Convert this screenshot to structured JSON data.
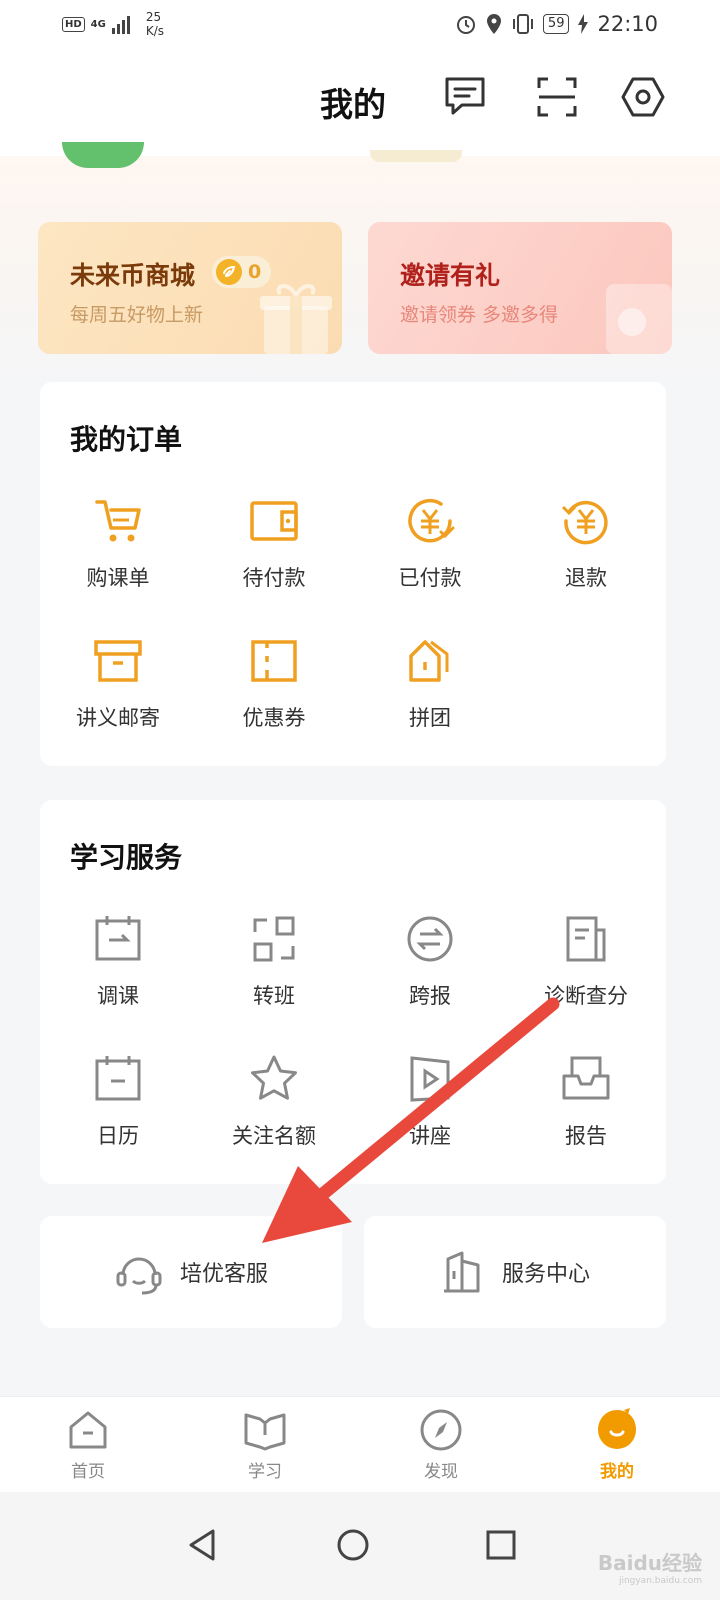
{
  "status_bar": {
    "hd": "HD",
    "network": "4G",
    "speed_value": "25",
    "speed_unit": "K/s",
    "battery": "59",
    "time": "22:10"
  },
  "header": {
    "title": "我的",
    "icons": [
      "message-icon",
      "scan-icon",
      "settings-icon"
    ]
  },
  "promos": {
    "mall": {
      "title": "未来币商城",
      "coin_count": "0",
      "subtitle": "每周五好物上新"
    },
    "invite": {
      "title": "邀请有礼",
      "subtitle": "邀请领券 多邀多得"
    }
  },
  "orders": {
    "title": "我的订单",
    "items": [
      {
        "label": "购课单",
        "icon": "cart-icon"
      },
      {
        "label": "待付款",
        "icon": "wallet-icon"
      },
      {
        "label": "已付款",
        "icon": "yuan-check-icon"
      },
      {
        "label": "退款",
        "icon": "yuan-refund-icon"
      },
      {
        "label": "讲义邮寄",
        "icon": "box-icon"
      },
      {
        "label": "优惠券",
        "icon": "coupon-icon"
      },
      {
        "label": "拼团",
        "icon": "group-buy-icon"
      }
    ]
  },
  "services": {
    "title": "学习服务",
    "items": [
      {
        "label": "调课",
        "icon": "reschedule-icon"
      },
      {
        "label": "转班",
        "icon": "transfer-class-icon"
      },
      {
        "label": "跨报",
        "icon": "cross-enroll-icon"
      },
      {
        "label": "诊断查分",
        "icon": "score-report-icon"
      },
      {
        "label": "日历",
        "icon": "calendar-icon"
      },
      {
        "label": "关注名额",
        "icon": "star-icon"
      },
      {
        "label": "讲座",
        "icon": "lecture-play-icon"
      },
      {
        "label": "报告",
        "icon": "inbox-report-icon"
      }
    ]
  },
  "support": {
    "customer_service": "培优客服",
    "service_center": "服务中心"
  },
  "bottom_nav": {
    "items": [
      {
        "label": "首页",
        "icon": "home-icon"
      },
      {
        "label": "学习",
        "icon": "book-icon"
      },
      {
        "label": "发现",
        "icon": "compass-icon"
      },
      {
        "label": "我的",
        "icon": "profile-icon"
      }
    ],
    "active_color": "#f29b00"
  },
  "watermark": {
    "text": "Baidu经验",
    "url": "jingyan.baidu.com"
  },
  "colors": {
    "accent_orange": "#f0a020",
    "arrow_red": "#e8493c"
  }
}
